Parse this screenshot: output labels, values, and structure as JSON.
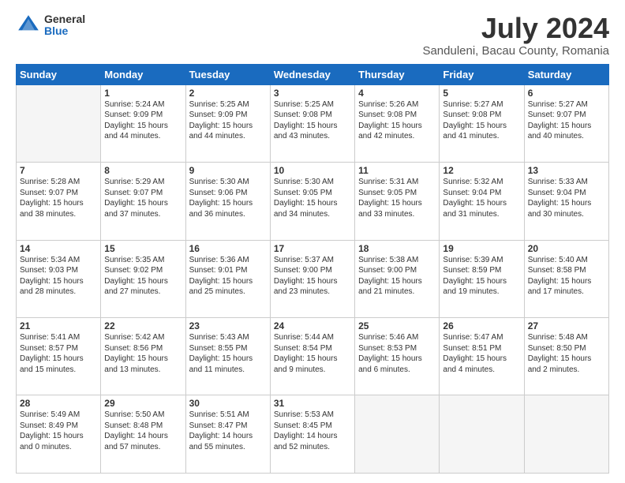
{
  "logo": {
    "general": "General",
    "blue": "Blue"
  },
  "title": "July 2024",
  "subtitle": "Sanduleni, Bacau County, Romania",
  "header_days": [
    "Sunday",
    "Monday",
    "Tuesday",
    "Wednesday",
    "Thursday",
    "Friday",
    "Saturday"
  ],
  "weeks": [
    [
      {
        "day": "",
        "info": "",
        "empty": true
      },
      {
        "day": "1",
        "info": "Sunrise: 5:24 AM\nSunset: 9:09 PM\nDaylight: 15 hours\nand 44 minutes."
      },
      {
        "day": "2",
        "info": "Sunrise: 5:25 AM\nSunset: 9:09 PM\nDaylight: 15 hours\nand 44 minutes."
      },
      {
        "day": "3",
        "info": "Sunrise: 5:25 AM\nSunset: 9:08 PM\nDaylight: 15 hours\nand 43 minutes."
      },
      {
        "day": "4",
        "info": "Sunrise: 5:26 AM\nSunset: 9:08 PM\nDaylight: 15 hours\nand 42 minutes."
      },
      {
        "day": "5",
        "info": "Sunrise: 5:27 AM\nSunset: 9:08 PM\nDaylight: 15 hours\nand 41 minutes."
      },
      {
        "day": "6",
        "info": "Sunrise: 5:27 AM\nSunset: 9:07 PM\nDaylight: 15 hours\nand 40 minutes."
      }
    ],
    [
      {
        "day": "7",
        "info": "Sunrise: 5:28 AM\nSunset: 9:07 PM\nDaylight: 15 hours\nand 38 minutes."
      },
      {
        "day": "8",
        "info": "Sunrise: 5:29 AM\nSunset: 9:07 PM\nDaylight: 15 hours\nand 37 minutes."
      },
      {
        "day": "9",
        "info": "Sunrise: 5:30 AM\nSunset: 9:06 PM\nDaylight: 15 hours\nand 36 minutes."
      },
      {
        "day": "10",
        "info": "Sunrise: 5:30 AM\nSunset: 9:05 PM\nDaylight: 15 hours\nand 34 minutes."
      },
      {
        "day": "11",
        "info": "Sunrise: 5:31 AM\nSunset: 9:05 PM\nDaylight: 15 hours\nand 33 minutes."
      },
      {
        "day": "12",
        "info": "Sunrise: 5:32 AM\nSunset: 9:04 PM\nDaylight: 15 hours\nand 31 minutes."
      },
      {
        "day": "13",
        "info": "Sunrise: 5:33 AM\nSunset: 9:04 PM\nDaylight: 15 hours\nand 30 minutes."
      }
    ],
    [
      {
        "day": "14",
        "info": "Sunrise: 5:34 AM\nSunset: 9:03 PM\nDaylight: 15 hours\nand 28 minutes."
      },
      {
        "day": "15",
        "info": "Sunrise: 5:35 AM\nSunset: 9:02 PM\nDaylight: 15 hours\nand 27 minutes."
      },
      {
        "day": "16",
        "info": "Sunrise: 5:36 AM\nSunset: 9:01 PM\nDaylight: 15 hours\nand 25 minutes."
      },
      {
        "day": "17",
        "info": "Sunrise: 5:37 AM\nSunset: 9:00 PM\nDaylight: 15 hours\nand 23 minutes."
      },
      {
        "day": "18",
        "info": "Sunrise: 5:38 AM\nSunset: 9:00 PM\nDaylight: 15 hours\nand 21 minutes."
      },
      {
        "day": "19",
        "info": "Sunrise: 5:39 AM\nSunset: 8:59 PM\nDaylight: 15 hours\nand 19 minutes."
      },
      {
        "day": "20",
        "info": "Sunrise: 5:40 AM\nSunset: 8:58 PM\nDaylight: 15 hours\nand 17 minutes."
      }
    ],
    [
      {
        "day": "21",
        "info": "Sunrise: 5:41 AM\nSunset: 8:57 PM\nDaylight: 15 hours\nand 15 minutes."
      },
      {
        "day": "22",
        "info": "Sunrise: 5:42 AM\nSunset: 8:56 PM\nDaylight: 15 hours\nand 13 minutes."
      },
      {
        "day": "23",
        "info": "Sunrise: 5:43 AM\nSunset: 8:55 PM\nDaylight: 15 hours\nand 11 minutes."
      },
      {
        "day": "24",
        "info": "Sunrise: 5:44 AM\nSunset: 8:54 PM\nDaylight: 15 hours\nand 9 minutes."
      },
      {
        "day": "25",
        "info": "Sunrise: 5:46 AM\nSunset: 8:53 PM\nDaylight: 15 hours\nand 6 minutes."
      },
      {
        "day": "26",
        "info": "Sunrise: 5:47 AM\nSunset: 8:51 PM\nDaylight: 15 hours\nand 4 minutes."
      },
      {
        "day": "27",
        "info": "Sunrise: 5:48 AM\nSunset: 8:50 PM\nDaylight: 15 hours\nand 2 minutes."
      }
    ],
    [
      {
        "day": "28",
        "info": "Sunrise: 5:49 AM\nSunset: 8:49 PM\nDaylight: 15 hours\nand 0 minutes."
      },
      {
        "day": "29",
        "info": "Sunrise: 5:50 AM\nSunset: 8:48 PM\nDaylight: 14 hours\nand 57 minutes."
      },
      {
        "day": "30",
        "info": "Sunrise: 5:51 AM\nSunset: 8:47 PM\nDaylight: 14 hours\nand 55 minutes."
      },
      {
        "day": "31",
        "info": "Sunrise: 5:53 AM\nSunset: 8:45 PM\nDaylight: 14 hours\nand 52 minutes."
      },
      {
        "day": "",
        "info": "",
        "empty": true
      },
      {
        "day": "",
        "info": "",
        "empty": true
      },
      {
        "day": "",
        "info": "",
        "empty": true
      }
    ]
  ]
}
